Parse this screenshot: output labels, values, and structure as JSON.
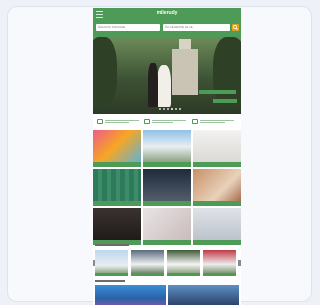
{
  "app": {
    "logo_text": "milerudy"
  },
  "search": {
    "field_one_text": "ŠALOVIC KOVIACE",
    "field_two_text": "ČO HĽADATE HL HL"
  },
  "hero": {
    "slide_count": 6,
    "active_slide": 4
  },
  "benefits": [
    {
      "icon": "monitor-icon"
    },
    {
      "icon": "calendar-icon"
    },
    {
      "icon": "tag-icon"
    }
  ],
  "categories": [
    {
      "icon": "bouncy-castle-photo"
    },
    {
      "icon": "white-tents-photo"
    },
    {
      "icon": "tent-interior-photo"
    },
    {
      "icon": "green-fence-photo"
    },
    {
      "icon": "rental-equipment-photo"
    },
    {
      "icon": "wooden-structure-photo"
    },
    {
      "icon": "wedding-decor-photo"
    },
    {
      "icon": "table-setting-photo"
    },
    {
      "icon": "mobile-cabin-photo"
    }
  ],
  "featured": {
    "thumb_count": 4
  },
  "colors": {
    "brand_green": "#4e9a57",
    "accent_orange": "#e0a21c"
  }
}
